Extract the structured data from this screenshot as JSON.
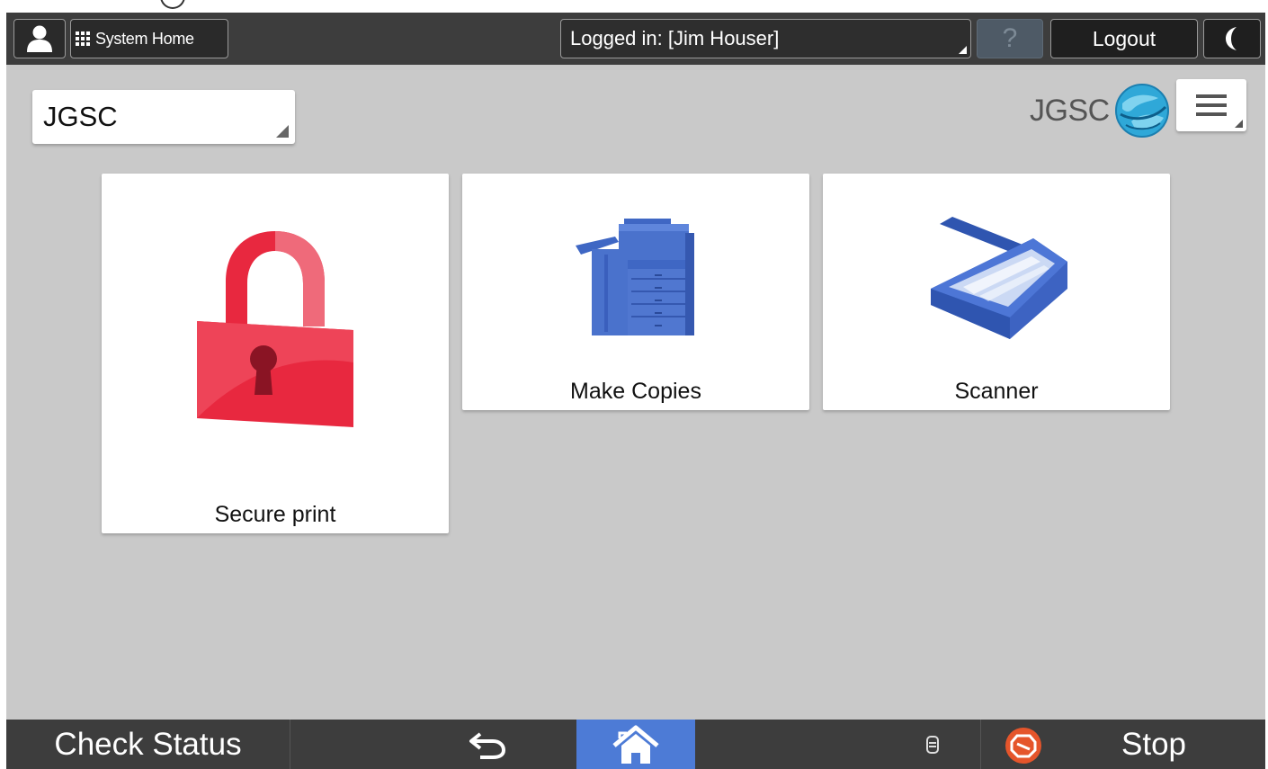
{
  "topbar": {
    "user_icon": "user-icon",
    "system_home_label": "System Home",
    "logged_in_label": "Logged in: [Jim Houser]",
    "help_label": "?",
    "logout_label": "Logout",
    "night_icon": "moon-icon"
  },
  "header": {
    "dropdown_value": "JGSC",
    "logo_text": "JGSC",
    "menu_icon": "hamburger-menu-icon"
  },
  "apps": [
    {
      "label": "Secure print",
      "icon": "padlock-icon"
    },
    {
      "label": "Make Copies",
      "icon": "copier-icon"
    },
    {
      "label": "Scanner",
      "icon": "scanner-icon"
    }
  ],
  "bottombar": {
    "check_status_label": "Check Status",
    "back_icon": "back-arrow-icon",
    "home_icon": "home-icon",
    "data_icon": "data-indicator-icon",
    "stop_label": "Stop"
  },
  "colors": {
    "bar_background": "#3d3d3d",
    "screen_background": "#c9c9c9",
    "home_key": "#4d7bd6",
    "lock_red": "#e8283f",
    "device_blue": "#4a72cc",
    "stop_orange": "#e5552b"
  }
}
